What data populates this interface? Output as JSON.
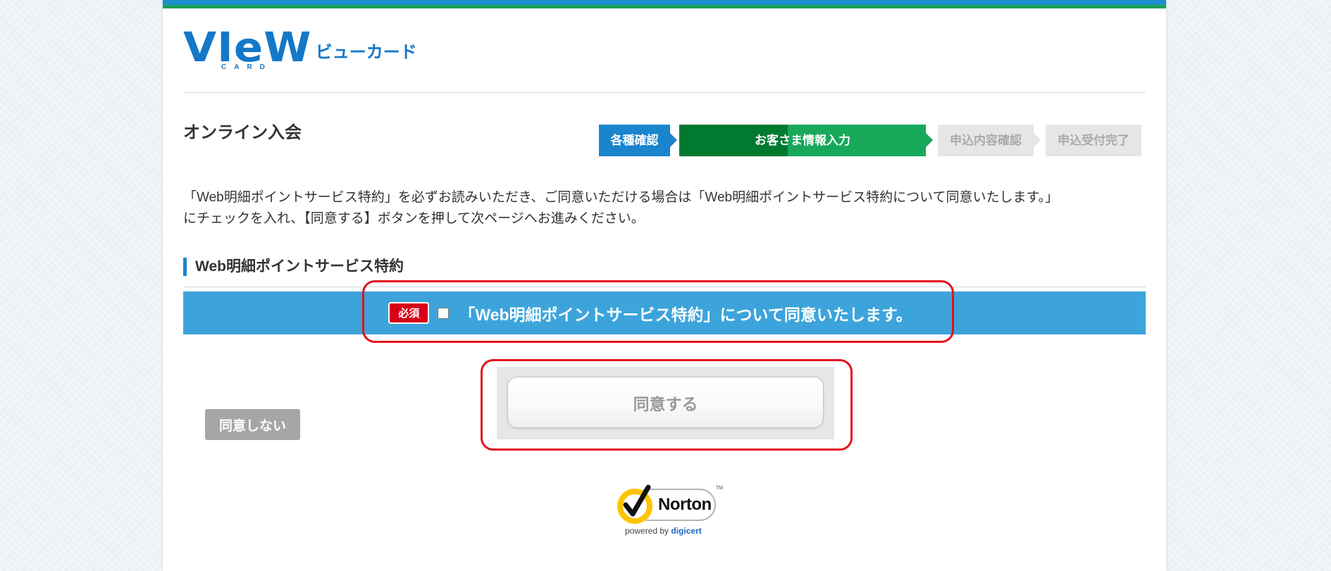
{
  "logo": {
    "word": "VIeW",
    "sub": "CARD",
    "kana": "ビューカード"
  },
  "page_title": "オンライン入会",
  "steps": [
    {
      "label": "各種確認",
      "state": "done"
    },
    {
      "label": "お客さま情報入力",
      "state": "current"
    },
    {
      "label": "申込内容確認",
      "state": "upcoming"
    },
    {
      "label": "申込受付完了",
      "state": "upcoming"
    }
  ],
  "intro": {
    "line1": "「Web明細ポイントサービス特約」を必ずお読みいただき、ご同意いただける場合は「Web明細ポイントサービス特約について同意いたします。」",
    "line2": "にチェックを入れ、【同意する】ボタンを押して次ページへお進みください。"
  },
  "section": {
    "heading": "Web明細ポイントサービス特約"
  },
  "agreement": {
    "required_badge": "必須",
    "checkbox_checked": false,
    "label": "「Web明細ポイントサービス特約」について同意いたします。"
  },
  "buttons": {
    "disagree": "同意しない",
    "agree": "同意する"
  },
  "norton": {
    "name": "Norton",
    "tm": "TM",
    "powered_by": "powered by",
    "digicert": "digicert"
  },
  "colors": {
    "brand_blue": "#1478c8",
    "step_done": "#1a85cd",
    "step_current_dark": "#007a30",
    "step_current_light": "#18a85a",
    "step_upcoming": "#e6e6e6",
    "agree_bar": "#3da4db",
    "required": "#d8001a",
    "annotation": "#e3101c"
  }
}
